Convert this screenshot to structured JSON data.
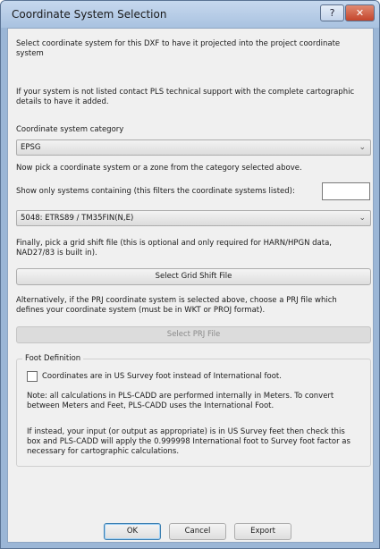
{
  "window": {
    "title": "Coordinate System Selection",
    "help_glyph": "?",
    "close_glyph": "✕"
  },
  "intro": {
    "line1": "Select coordinate system for this DXF to have it projected into the project coordinate",
    "line2": "system",
    "support1": "If your system is not listed contact PLS technical support with the complete cartographic",
    "support2": "details to have it added."
  },
  "category": {
    "label": "Coordinate system category",
    "value": "EPSG"
  },
  "system": {
    "pick_label": "Now pick a coordinate system or a zone from the category selected above.",
    "filter_label": "Show only systems containing (this filters the coordinate systems listed):",
    "filter_value": "",
    "value": "5048: ETRS89 / TM35FIN(N,E)"
  },
  "grid_shift": {
    "line1": "Finally, pick a grid shift file (this is optional and only required for HARN/HPGN data,",
    "line2": "NAD27/83 is built in).",
    "button_label": "Select Grid Shift File"
  },
  "prj": {
    "line1": "Alternatively, if the PRJ coordinate system is selected above, choose a PRJ file which",
    "line2": "defines your coordinate system (must be in WKT or PROJ format).",
    "button_label": "Select PRJ File"
  },
  "foot": {
    "legend": "Foot Definition",
    "checkbox_label": "Coordinates are in US Survey foot instead of International foot.",
    "checked": false,
    "note1": "Note: all calculations in PLS-CADD are performed internally in Meters.  To convert",
    "note2": "between Meters and Feet, PLS-CADD uses the International Foot.",
    "info1": "If instead, your input (or output as appropriate) is in US Survey feet then check this",
    "info2": "box and PLS-CADD will apply the 0.999998 International foot to Survey foot factor as",
    "info3": "necessary for cartographic calculations."
  },
  "buttons": {
    "ok": "OK",
    "cancel": "Cancel",
    "export": "Export"
  },
  "icons": {
    "dropdown": "chevron-down-icon",
    "help": "help-icon",
    "close": "close-icon"
  }
}
